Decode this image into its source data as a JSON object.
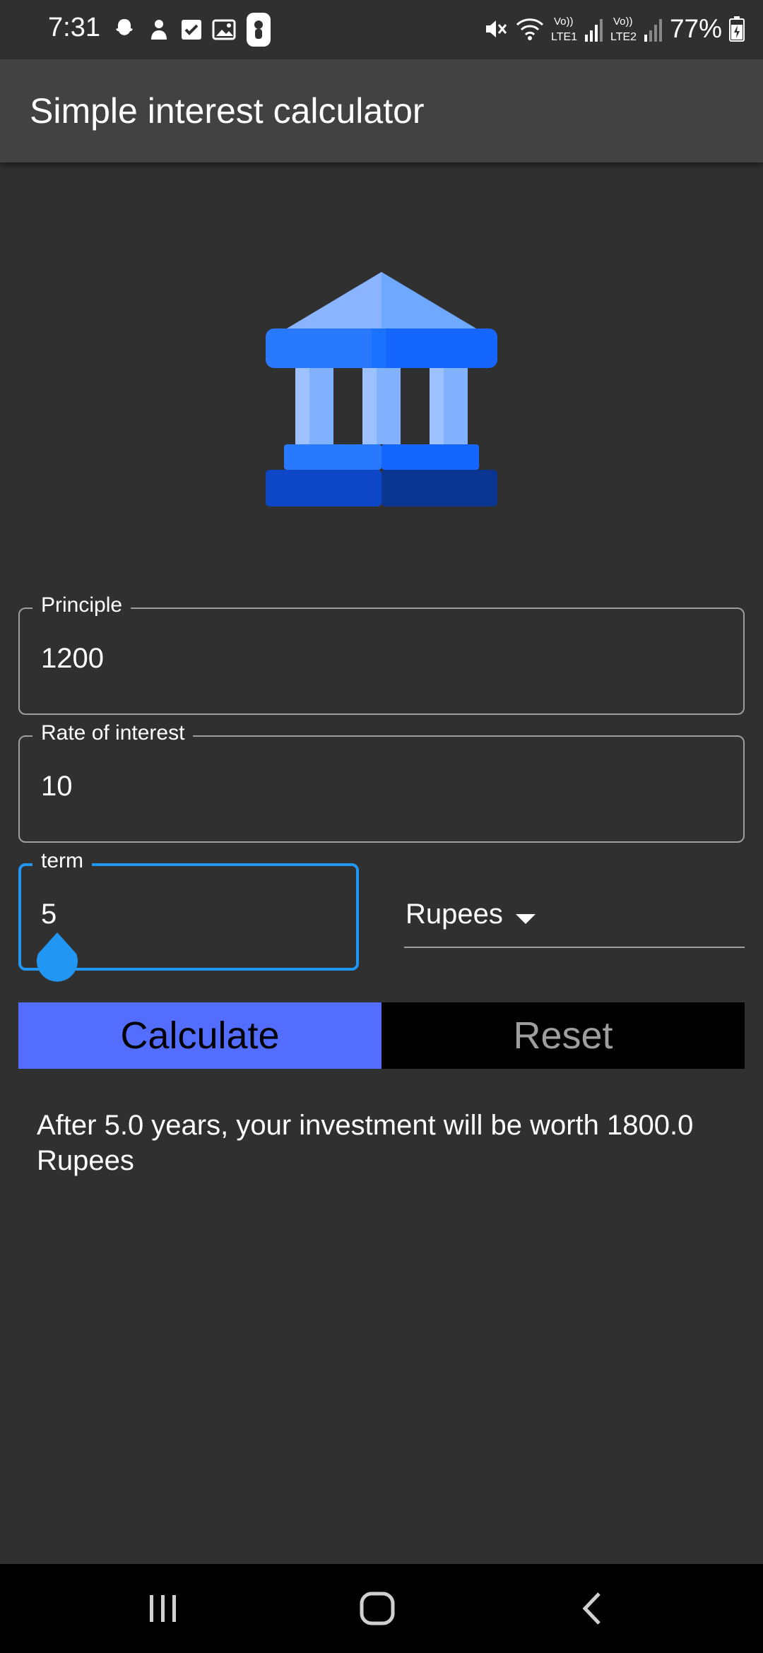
{
  "status_bar": {
    "time": "7:31",
    "battery": "77%",
    "icons_left": [
      "snapchat-icon",
      "duo-icon",
      "checkbox-icon",
      "gallery-icon",
      "app-icon"
    ],
    "icons_right": [
      "mute-icon",
      "wifi-icon",
      "lte1-signal-icon",
      "lte2-signal-icon",
      "battery-charging-icon"
    ],
    "lte1_label": "LTE1",
    "lte2_label": "LTE2",
    "volte_label": "Vo))"
  },
  "app_bar": {
    "title": "Simple interest calculator"
  },
  "image": {
    "icon": "bank-icon"
  },
  "form": {
    "principal": {
      "label": "Principle",
      "value": "1200"
    },
    "rate": {
      "label": "Rate of interest",
      "value": "10"
    },
    "term": {
      "label": "term",
      "value": "5"
    },
    "currency": {
      "selected": "Rupees"
    }
  },
  "buttons": {
    "calculate": "Calculate",
    "reset": "Reset"
  },
  "result": {
    "text": "After 5.0 years, your investment will be worth 1800.0 Rupees"
  },
  "colors": {
    "background": "#303030",
    "app_bar": "#424242",
    "accent": "#536dfe",
    "focus": "#2196f3"
  },
  "nav_bar": {
    "icons": [
      "recents-icon",
      "home-icon",
      "back-icon"
    ]
  }
}
